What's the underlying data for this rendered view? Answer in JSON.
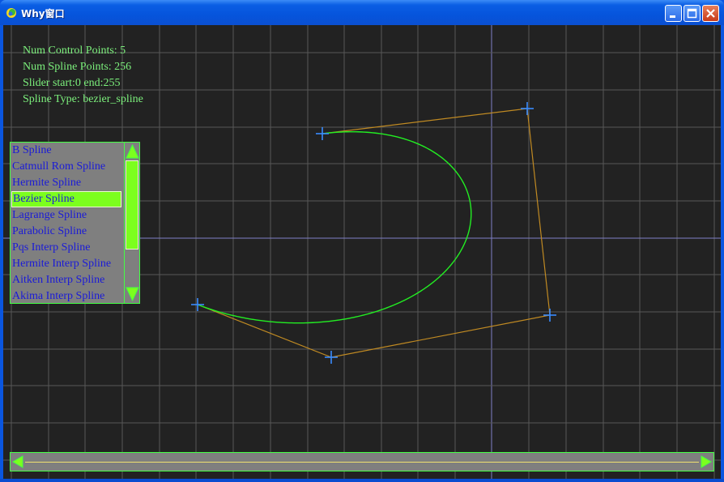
{
  "window": {
    "title": "Why窗口",
    "minimize_label": "minimize",
    "maximize_label": "maximize",
    "close_label": "close"
  },
  "info": {
    "num_control_points": "Num Control Points: 5",
    "num_spline_points": "Num Spline Points: 256",
    "slider_range": "Slider start:0 end:255",
    "spline_type": "Spline Type: bezier_spline"
  },
  "spline_list": {
    "items": [
      "B Spline",
      "Catmull Rom Spline",
      "Hermite Spline",
      "Bezier Spline",
      "Lagrange Spline",
      "Parabolic Spline",
      "Pqs Interp Spline",
      "Hermite Interp Spline",
      "Aitken Interp Spline",
      "Akima Interp Spline"
    ],
    "selected_index": 3
  },
  "slider": {
    "start": 0,
    "end": 255
  },
  "colors": {
    "background": "#222222",
    "grid": "#585858",
    "grid_highlight": "#8080c8",
    "curve": "#22ee22",
    "control_polygon": "#c08a22",
    "control_point": "#3a8cff",
    "list_text": "#1a1ad8",
    "selection": "#7cff1e",
    "info_text": "#7cf07c"
  }
}
